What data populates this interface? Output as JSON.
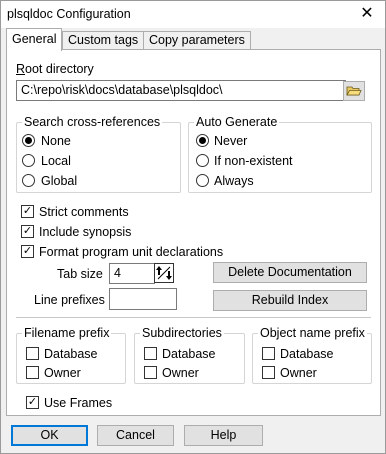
{
  "window": {
    "title": "plsqldoc Configuration",
    "close_glyph": "✕"
  },
  "tabs": [
    {
      "label": "General",
      "active": true
    },
    {
      "label": "Custom tags",
      "active": false
    },
    {
      "label": "Copy parameters",
      "active": false
    }
  ],
  "root_directory": {
    "label_first": "R",
    "label_rest": "oot directory",
    "value": "C:\\repo\\risk\\docs\\database\\plsqldoc\\"
  },
  "search_cross_references": {
    "title": "Search cross-references",
    "options": [
      "None",
      "Local",
      "Global"
    ],
    "selected": "None"
  },
  "auto_generate": {
    "title": "Auto Generate",
    "options": [
      "Never",
      "If non-existent",
      "Always"
    ],
    "selected": "Never"
  },
  "checkboxes": {
    "strict_comments": {
      "label": "Strict comments",
      "checked": true
    },
    "include_synopsis": {
      "label": "Include synopsis",
      "checked": true
    },
    "format_program_unit": {
      "label": "Format program unit declarations",
      "checked": true
    }
  },
  "tab_size": {
    "label": "Tab size",
    "value": "4"
  },
  "line_prefixes": {
    "label": "Line prefixes",
    "value": ""
  },
  "buttons": {
    "delete_documentation": "Delete Documentation",
    "rebuild_index": "Rebuild Index",
    "ok": "OK",
    "cancel": "Cancel",
    "help": "Help"
  },
  "filename_prefix": {
    "title": "Filename prefix",
    "database": {
      "label": "Database",
      "checked": false
    },
    "owner": {
      "label": "Owner",
      "checked": false
    }
  },
  "subdirectories": {
    "title": "Subdirectories",
    "database": {
      "label": "Database",
      "checked": false
    },
    "owner": {
      "label": "Owner",
      "checked": false
    }
  },
  "object_name_prefix": {
    "title": "Object name prefix",
    "database": {
      "label": "Database",
      "checked": false
    },
    "owner": {
      "label": "Owner",
      "checked": false
    }
  },
  "use_frames": {
    "label": "Use Frames",
    "checked": true
  },
  "colors": {
    "default_button_border": "#0078d7",
    "tab_active_bg": "#ffffff",
    "dialog_bg": "#f0f0f0"
  },
  "check_glyph": "✓"
}
